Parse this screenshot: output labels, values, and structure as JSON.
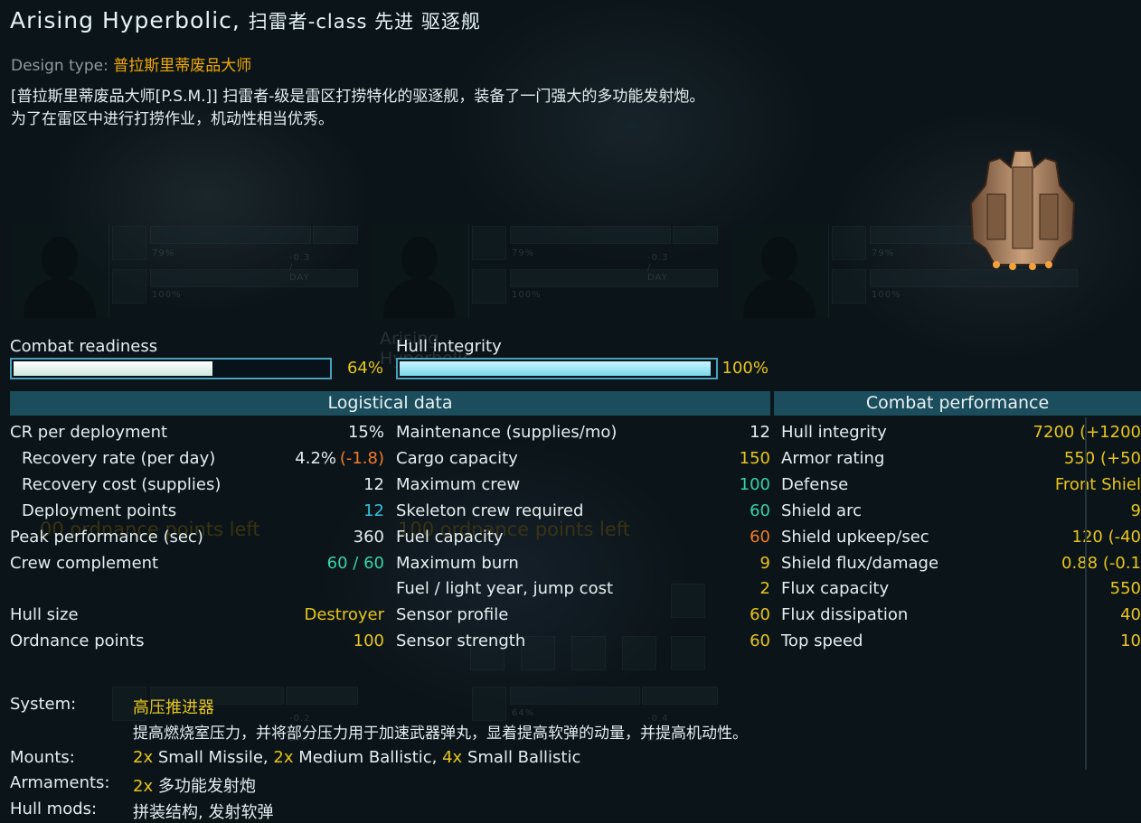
{
  "header": {
    "ship_name": "Arising Hyperbolic,",
    "ship_class": "扫雷者-class 先进 驱逐舰",
    "design_type_label": "Design type:",
    "design_type_value": "普拉斯里蒂废品大师",
    "description_line1": "[普拉斯里蒂废品大师[P.S.M.]] 扫雷者-级是雷区打捞特化的驱逐舰，装备了一门强大的多功能发射炮。",
    "description_line2": "为了在雷区中进行打捞作业，机动性相当优秀。"
  },
  "background": {
    "ghost_pct_1": "79%",
    "ghost_pct_2": "79%",
    "ghost_pct_3": "79%",
    "ghost_cost_1": "-0.3 / DAY",
    "ghost_cost_2": "-0.3 / DAY",
    "ghost_full_1": "100%",
    "ghost_full_2": "100%",
    "ghost_full_3": "100%",
    "ghost_name": "Arising Hyperbolic",
    "ghost_op_1": "00 ordnance points left",
    "ghost_op_2": "100 ordnance points left",
    "ghost_pct_4": "64%",
    "ghost_cost_3": "-0.2 / DAY",
    "ghost_cost_4": "-0.4 / DAY"
  },
  "readiness": {
    "combat_readiness_label": "Combat readiness",
    "combat_readiness_value": "64%",
    "combat_readiness_fraction": 0.64,
    "hull_integrity_label": "Hull integrity",
    "hull_integrity_value": "100%",
    "hull_integrity_fraction": 1.0
  },
  "logistical": {
    "header": "Logistical data",
    "col1": [
      {
        "label": "CR per deployment",
        "value": "15%",
        "extra": "",
        "indent": false,
        "color": "w"
      },
      {
        "label": "Recovery rate (per day)",
        "value": "4.2%",
        "extra": "(-1.8)",
        "indent": true,
        "color": "w"
      },
      {
        "label": "Recovery cost (supplies)",
        "value": "12",
        "extra": "",
        "indent": true,
        "color": "w"
      },
      {
        "label": "Deployment points",
        "value": "12",
        "extra": "",
        "indent": true,
        "color": "b"
      },
      {
        "label": "Peak performance (sec)",
        "value": "360",
        "extra": "",
        "indent": false,
        "color": "w"
      },
      {
        "label": "Crew complement",
        "value": "60 / 60",
        "extra": "",
        "indent": false,
        "color": "g"
      },
      {
        "label": "",
        "value": "",
        "extra": "",
        "indent": false,
        "color": "w"
      },
      {
        "label": "Hull size",
        "value": "Destroyer",
        "extra": "",
        "indent": false,
        "color": "y"
      },
      {
        "label": "Ordnance points",
        "value": "100",
        "extra": "",
        "indent": false,
        "color": "y"
      }
    ],
    "col2": [
      {
        "label": "Maintenance (supplies/mo)",
        "value": "12",
        "color": "w"
      },
      {
        "label": "Cargo capacity",
        "value": "150",
        "color": "y"
      },
      {
        "label": "Maximum crew",
        "value": "100",
        "color": "g"
      },
      {
        "label": "Skeleton crew required",
        "value": "60",
        "color": "g"
      },
      {
        "label": "Fuel capacity",
        "value": "60",
        "color": "o"
      },
      {
        "label": "Maximum burn",
        "value": "9",
        "color": "y"
      },
      {
        "label": "Fuel / light year, jump cost",
        "value": "2",
        "color": "y"
      },
      {
        "label": "Sensor profile",
        "value": "60",
        "color": "y"
      },
      {
        "label": "Sensor strength",
        "value": "60",
        "color": "y"
      }
    ]
  },
  "combat": {
    "header": "Combat performance",
    "rows": [
      {
        "label": "Hull integrity",
        "value": "7200 (+1200"
      },
      {
        "label": "Armor rating",
        "value": "550 (+50"
      },
      {
        "label": "Defense",
        "value": "Front Shiel"
      },
      {
        "label": "Shield arc",
        "value": "9"
      },
      {
        "label": "Shield upkeep/sec",
        "value": "120 (-40"
      },
      {
        "label": "Shield flux/damage",
        "value": "0.88 (-0.1"
      },
      {
        "label": "Flux capacity",
        "value": "550"
      },
      {
        "label": "Flux dissipation",
        "value": "40"
      },
      {
        "label": "Top speed",
        "value": "10"
      }
    ]
  },
  "system": {
    "system_label": "System:",
    "system_name": "高压推进器",
    "system_desc": "提高燃烧室压力，并将部分压力用于加速武器弹丸，显着提高软弹的动量，并提高机动性。",
    "mounts_label": "Mounts:",
    "mounts": [
      {
        "count": "2x",
        "text": "Small Missile,"
      },
      {
        "count": "2x",
        "text": "Medium Ballistic,"
      },
      {
        "count": "4x",
        "text": "Small Ballistic"
      }
    ],
    "armaments_label": "Armaments:",
    "armaments_count": "2x",
    "armaments_text": "多功能发射炮",
    "hullmods_label": "Hull mods:",
    "hullmods_text": "拼装结构, 发射软弹"
  },
  "colors": {
    "accent": "#1c4d5c",
    "yellow": "#e9c51c",
    "orange": "#f27c2b",
    "green": "#37d3a4",
    "cyan": "#2ec4de",
    "bar_border": "#4aa0b8"
  }
}
